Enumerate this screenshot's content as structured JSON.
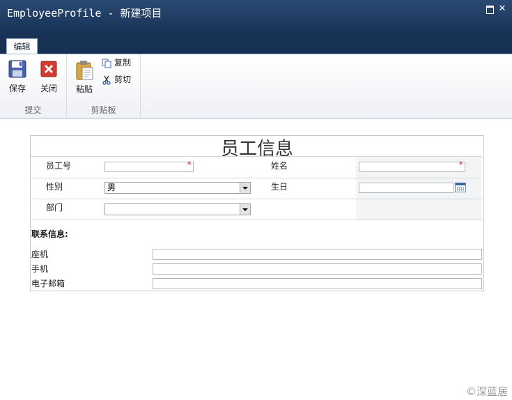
{
  "window": {
    "title": "EmployeeProfile - 新建项目",
    "maximize_icon": "maximize-icon",
    "close_label": "✕"
  },
  "ribbon": {
    "tab": "编辑",
    "groups": {
      "commit": {
        "label": "提交",
        "save": "保存",
        "close": "关闭"
      },
      "clipboard": {
        "label": "剪贴板",
        "paste": "粘贴",
        "copy": "复制",
        "cut": "剪切"
      }
    }
  },
  "form": {
    "title": "员工信息",
    "fields": {
      "employee_id": {
        "label": "员工号",
        "required": "*",
        "value": ""
      },
      "name": {
        "label": "姓名",
        "required": "*",
        "value": ""
      },
      "gender": {
        "label": "性别",
        "selected": "男"
      },
      "birthday": {
        "label": "生日",
        "value": ""
      },
      "department": {
        "label": "部门",
        "selected": ""
      }
    },
    "contact": {
      "heading": "联系信息:",
      "landline": {
        "label": "座机",
        "value": ""
      },
      "mobile": {
        "label": "手机",
        "value": ""
      },
      "email": {
        "label": "电子邮箱",
        "value": ""
      }
    }
  },
  "watermark": "©深蓝居"
}
